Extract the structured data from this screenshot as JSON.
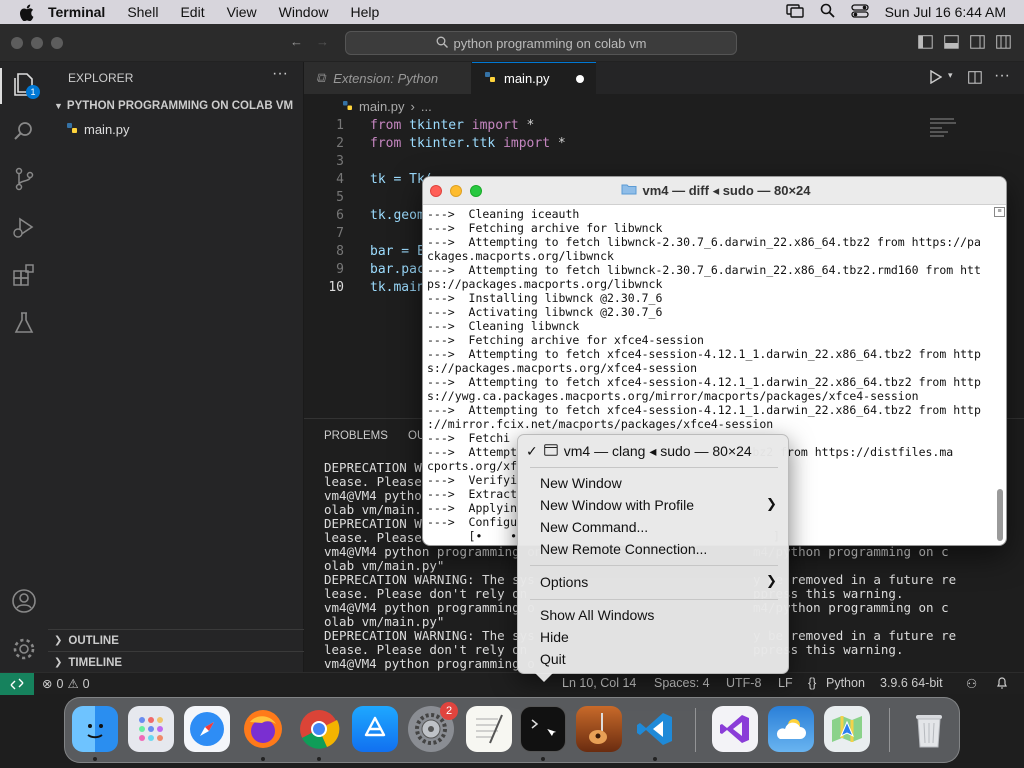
{
  "menubar": {
    "app": "Terminal",
    "items": [
      "Shell",
      "Edit",
      "View",
      "Window",
      "Help"
    ],
    "clock": "Sun Jul 16  6:44 AM"
  },
  "vscode": {
    "search": "python programming on colab vm",
    "explorer_title": "EXPLORER",
    "explorer_badge": "1",
    "folder": "PYTHON PROGRAMMING ON COLAB VM",
    "file": "main.py",
    "outline": "OUTLINE",
    "timeline": "TIMELINE",
    "tabs": [
      {
        "label": "Extension: Python"
      },
      {
        "label": "main.py"
      }
    ],
    "breadcrumb": [
      "main.py",
      "..."
    ],
    "line_numbers": [
      "1",
      "2",
      "3",
      "4",
      "5",
      "6",
      "7",
      "8",
      "9",
      "10"
    ],
    "code": [
      {
        "kw1": "from",
        "mid": " tkinter ",
        "kw2": "import",
        "rest": " *"
      },
      {
        "kw1": "from",
        "mid": " tkinter.ttk ",
        "kw2": "import",
        "rest": " *"
      },
      {
        "kw1": "",
        "mid": "",
        "kw2": "",
        "rest": ""
      },
      {
        "kw1": "",
        "mid": "tk = Tk(",
        "kw2": "",
        "rest": ""
      },
      {
        "kw1": "",
        "mid": "",
        "kw2": "",
        "rest": ""
      },
      {
        "kw1": "",
        "mid": "tk.geom",
        "kw2": "",
        "rest": ""
      },
      {
        "kw1": "",
        "mid": "",
        "kw2": "",
        "rest": ""
      },
      {
        "kw1": "",
        "mid": "bar = E",
        "kw2": "",
        "rest": ""
      },
      {
        "kw1": "",
        "mid": "bar.pac",
        "kw2": "",
        "rest": ""
      },
      {
        "kw1": "",
        "mid": "tk.main",
        "kw2": "",
        "rest": ""
      }
    ],
    "panel_tabs": [
      "PROBLEMS",
      "OU"
    ],
    "panel_lines": [
      "DEPRECATION WA",
      "lease. Please",
      "vm4@VM4 python",
      "olab vm/main.p",
      "DEPRECATION WA",
      "lease. Please",
      "vm4@VM4 python programming on c                          m4/python programming on c",
      "olab vm/main.py\"",
      "DEPRECATION WARNING: The sys                             y be removed in a future re",
      "lease. Please don't rely on                              ppress this warning.",
      "vm4@VM4 python programming o                             m4/python programming on c",
      "olab vm/main.py\"",
      "DEPRECATION WARNING: The sys                             y be removed in a future re",
      "lease. Please don't rely on                              ppress this warning.",
      "vm4@VM4 python programming o"
    ],
    "status": {
      "errors": "0",
      "warnings": "0",
      "position": "Ln 10, Col 14",
      "spaces": "Spaces: 4",
      "encoding": "UTF-8",
      "eol": "LF",
      "language": "Python",
      "interpreter": "3.9.6 64-bit"
    }
  },
  "terminal": {
    "title": "vm4 — diff ◂ sudo — 80×24",
    "lines": [
      "--->  Cleaning iceauth",
      "--->  Fetching archive for libwnck",
      "--->  Attempting to fetch libwnck-2.30.7_6.darwin_22.x86_64.tbz2 from https://pa",
      "ckages.macports.org/libwnck",
      "--->  Attempting to fetch libwnck-2.30.7_6.darwin_22.x86_64.tbz2.rmd160 from htt",
      "ps://packages.macports.org/libwnck",
      "--->  Installing libwnck @2.30.7_6",
      "--->  Activating libwnck @2.30.7_6",
      "--->  Cleaning libwnck",
      "--->  Fetching archive for xfce4-session",
      "--->  Attempting to fetch xfce4-session-4.12.1_1.darwin_22.x86_64.tbz2 from http",
      "s://packages.macports.org/xfce4-session",
      "--->  Attempting to fetch xfce4-session-4.12.1_1.darwin_22.x86_64.tbz2 from http",
      "s://ywg.ca.packages.macports.org/mirror/macports/packages/xfce4-session",
      "--->  Attempting to fetch xfce4-session-4.12.1_1.darwin_22.x86_64.tbz2 from http",
      "://mirror.fcix.net/macports/packages/xfce4-session",
      "--->  Fetchi",
      "--->  Attempt                                  bz2 from https://distfiles.ma",
      "cports.org/xf",
      "--->  Verifyi",
      "--->  Extract",
      "--->  Applyin",
      "--->  Configu",
      "      [•    •                                     ]"
    ]
  },
  "context_menu": {
    "window_item": "vm4 — clang ◂ sudo — 80×24",
    "items": {
      "new_window": "New Window",
      "new_window_profile": "New Window with Profile",
      "new_command": "New Command...",
      "new_remote": "New Remote Connection...",
      "options": "Options",
      "show_all": "Show All Windows",
      "hide": "Hide",
      "quit": "Quit"
    }
  },
  "dock": {
    "settings_badge": "2"
  },
  "colors": {
    "accent": "#0078d4",
    "remote_green": "#16825d",
    "badge_red": "#e0443e"
  }
}
